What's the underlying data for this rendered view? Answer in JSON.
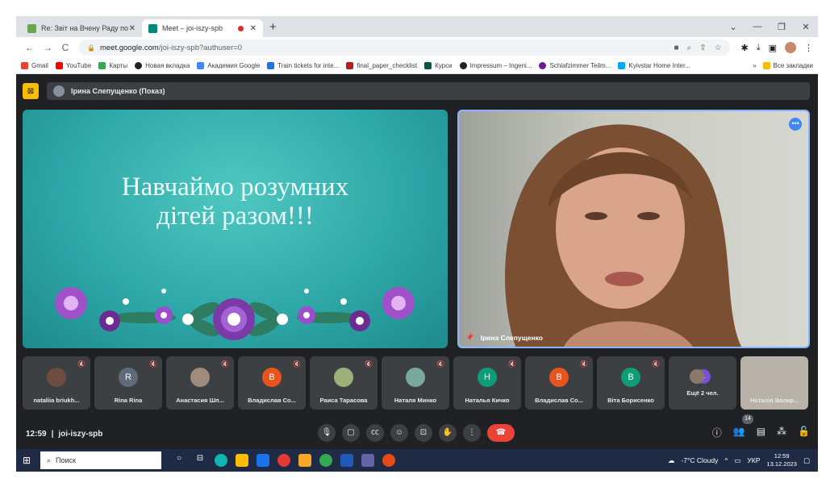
{
  "browser": {
    "tabs": [
      {
        "title": "Re: Звіт на Вчену Раду по ДО -",
        "favicon_color": "#6aa84f"
      },
      {
        "title": "Meet – joi-iszy-spb",
        "favicon_color": "#00897b"
      }
    ],
    "url_host": "meet.google.com",
    "url_path": "/joi-iszy-spb?authuser=0",
    "bookmarks": [
      "Gmail",
      "YouTube",
      "Карты",
      "Новая вкладка",
      "Академия Google",
      "Train tickets for inte...",
      "final_paper_checklist",
      "Курси",
      "Impressum – Ingeni...",
      "Schlafzimmer Teilm...",
      "Kyivstar Home Inter..."
    ],
    "bookmarks_more": "»",
    "all_bookmarks": "Все закладки"
  },
  "meet": {
    "presenter_chip": "Ірина Слепущенко (Показ)",
    "slide_line1": "Навчаймо розумних",
    "slide_line2": "дітей разом!!!",
    "video_name": "Ірина Слепущенко",
    "tiles": [
      {
        "name": "nataliia briukh...",
        "initial": "",
        "color": "#6d4c41"
      },
      {
        "name": "Rina Rina",
        "initial": "R",
        "color": "#5f6b7a"
      },
      {
        "name": "Анастасия Шп...",
        "initial": "",
        "color": "#a08c7a"
      },
      {
        "name": "Владислав Со...",
        "initial": "B",
        "color": "#e8541b"
      },
      {
        "name": "Раиса Тарасова",
        "initial": "",
        "color": "#9db07a"
      },
      {
        "name": "Наталя Минко",
        "initial": "",
        "color": "#7aa89a"
      },
      {
        "name": "Наталья Кичко",
        "initial": "H",
        "color": "#0e9d76"
      },
      {
        "name": "Владислав Со...",
        "initial": "B",
        "color": "#e8541b"
      },
      {
        "name": "Віта Борисенко",
        "initial": "B",
        "color": "#0e9d76"
      },
      {
        "name": "Ещё 2 чел.",
        "initial": "L",
        "color": "#7b4fd6"
      },
      {
        "name": "Наталія Валер...",
        "initial": "",
        "color": "#b8b2a8"
      }
    ],
    "time": "12:59",
    "meeting_code": "joi-iszy-spb",
    "participants_count": "14"
  },
  "taskbar": {
    "search_placeholder": "Поиск",
    "weather": "-7°C  Cloudy",
    "lang": "УКР",
    "time": "12:59",
    "date": "13.12.2023"
  }
}
